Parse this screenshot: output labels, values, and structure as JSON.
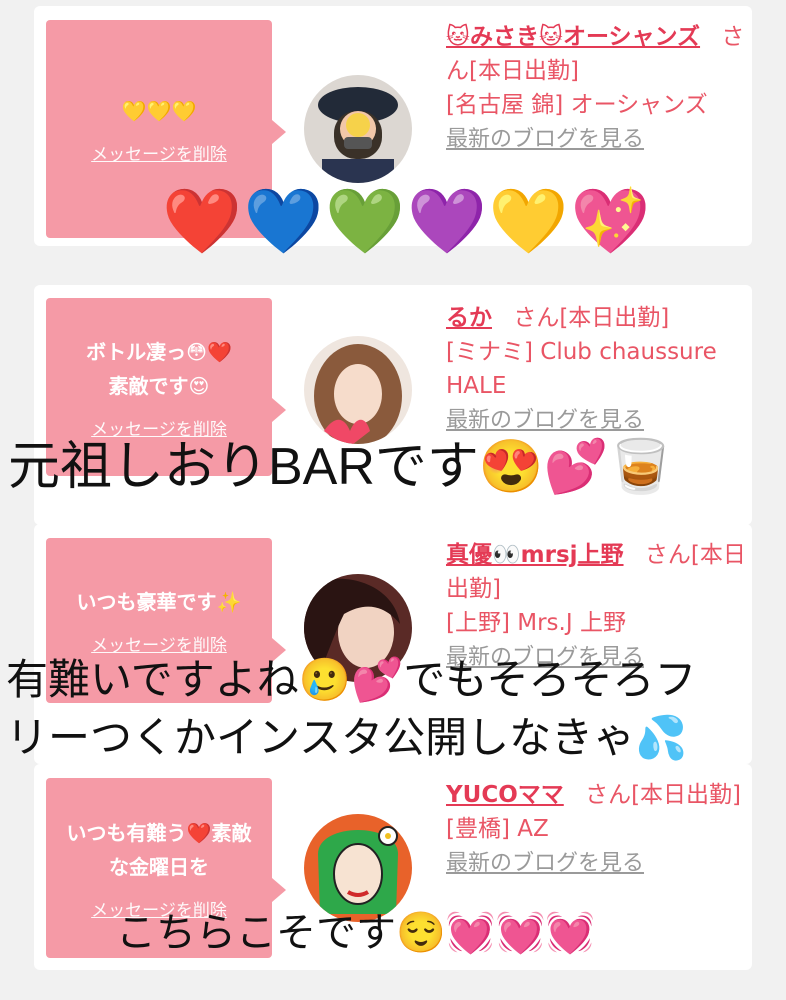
{
  "cards": [
    {
      "message": "💛💛💛",
      "delete_label": "メッセージを削除",
      "name": "🐱みさき🐱オーシャンズ",
      "san": "さん",
      "status": "[本日出勤]",
      "shop": "[名古屋 錦] オーシャンズ",
      "blog_label": "最新のブログを見る"
    },
    {
      "message": "ボトル凄っ😳❤️\n素敵です😍",
      "delete_label": "メッセージを削除",
      "name": "るか",
      "san": "さん",
      "status": "[本日出勤]",
      "shop": "[ミナミ] Club chaussure HALE",
      "blog_label": "最新のブログを見る"
    },
    {
      "message": "いつも豪華です✨",
      "delete_label": "メッセージを削除",
      "name": "真優👀mrsj上野",
      "san": "さん",
      "status": "[本日出勤]",
      "shop": "[上野] Mrs.J 上野",
      "blog_label": "最新のブログを見る"
    },
    {
      "message": "いつも有難う❤️素敵な金曜日を",
      "delete_label": "メッセージを削除",
      "name": "YUCOママ",
      "san": "さん",
      "status": "[本日出勤]",
      "shop": "[豊橋] AZ",
      "blog_label": "最新のブログを見る"
    }
  ],
  "overlays": {
    "hearts": "❤️💙💚💜💛💖",
    "line1": "元祖しおりBARです😍💕🥃",
    "line2": "有難いですよね🥲💕でもそろそろフ",
    "line3": "リーつくかインスタ公開しなきゃ💦",
    "line4": "こちらこそです😌💓💓💓"
  }
}
